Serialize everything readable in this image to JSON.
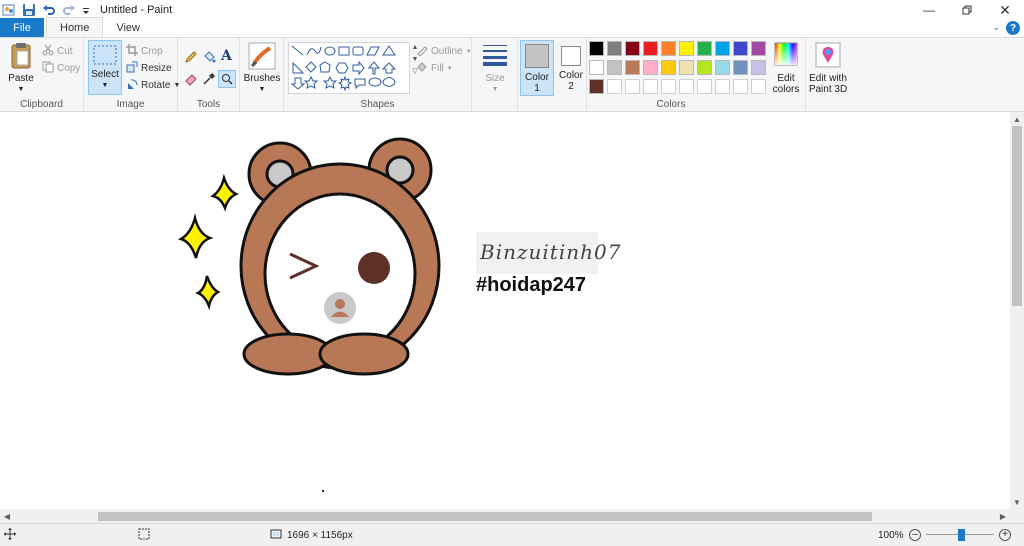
{
  "window": {
    "title": "Untitled - Paint"
  },
  "tabs": {
    "file": "File",
    "home": "Home",
    "view": "View"
  },
  "clipboard": {
    "paste": "Paste",
    "cut": "Cut",
    "copy": "Copy",
    "label": "Clipboard"
  },
  "image": {
    "select": "Select",
    "crop": "Crop",
    "resize": "Resize",
    "rotate": "Rotate",
    "label": "Image"
  },
  "tools": {
    "label": "Tools"
  },
  "brushes": {
    "label": "Brushes"
  },
  "shapes": {
    "outline": "Outline",
    "fill": "Fill",
    "label": "Shapes"
  },
  "size": {
    "label": "Size"
  },
  "color1": {
    "label": "Color",
    "number": "1"
  },
  "color2": {
    "label": "Color",
    "number": "2"
  },
  "colors": {
    "label": "Colors",
    "row1": [
      "#000000",
      "#7f7f7f",
      "#880015",
      "#ed1c24",
      "#ff7f27",
      "#fff200",
      "#22b14c",
      "#00a2e8",
      "#3f48cc",
      "#a349a4"
    ],
    "row2": [
      "#ffffff",
      "#c3c3c3",
      "#b97a57",
      "#ffaec9",
      "#ffc90e",
      "#efe4b0",
      "#b5e61d",
      "#99d9ea",
      "#7092be",
      "#c8bfe7"
    ],
    "row3": [
      "#5e3128",
      "",
      "",
      "",
      "",
      "",
      "",
      "",
      "",
      ""
    ],
    "color1_value": "#c3c3c3",
    "color2_value": "#ffffff"
  },
  "edit_colors": {
    "line1": "Edit",
    "line2": "colors"
  },
  "paint3d": {
    "line1": "Edit with",
    "line2": "Paint 3D"
  },
  "canvas": {
    "signature": "Binzuitinh07",
    "hashtag": "#hoidap247"
  },
  "status": {
    "dimensions": "1696 × 1156px",
    "zoom": "100%"
  }
}
